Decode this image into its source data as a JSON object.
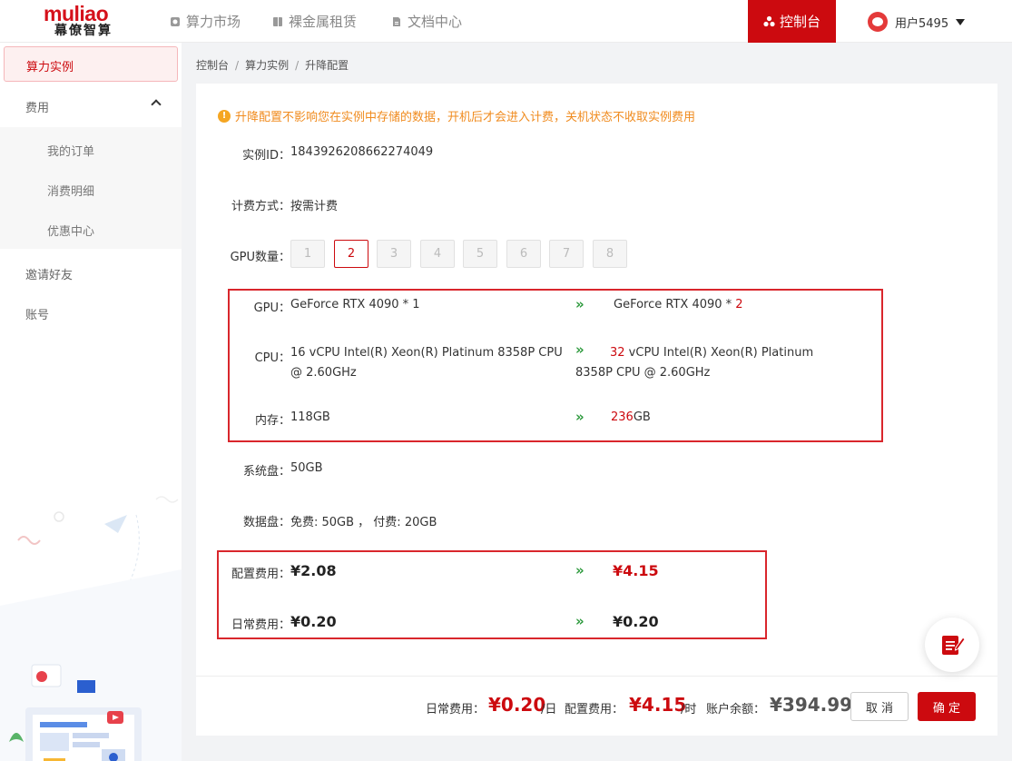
{
  "brand": {
    "logo_top": "muliao",
    "logo_bottom": "幕僚智算",
    "accent": "#cc0a0f"
  },
  "nav": {
    "items": [
      {
        "label": "算力市场",
        "icon": "cube-icon"
      },
      {
        "label": "裸金属租赁",
        "icon": "server-icon"
      },
      {
        "label": "文档中心",
        "icon": "document-icon"
      }
    ],
    "console_label": "控制台",
    "user_label": "用户5495"
  },
  "sidebar": {
    "active": "算力实例",
    "fees": "费用",
    "sub": [
      "我的订单",
      "消费明细",
      "优惠中心"
    ],
    "invite": "邀请好友",
    "account": "账号"
  },
  "breadcrumb": [
    "控制台",
    "算力实例",
    "升降配置"
  ],
  "notice": "升降配置不影响您在实例中存储的数据，开机后才会进入计费，关机状态不收取实例费用",
  "instance": {
    "id_label": "实例ID：",
    "id": "1843926208662274049",
    "billing_label": "计费方式：",
    "billing": "按需计费",
    "gpu_count_label": "GPU数量：",
    "gpu_options": [
      "1",
      "2",
      "3",
      "4",
      "5",
      "6",
      "7",
      "8"
    ],
    "gpu_selected": "2"
  },
  "compare": {
    "gpu_label": "GPU：",
    "gpu_old": "GeForce RTX 4090 * 1",
    "gpu_new_prefix": "GeForce RTX 4090 * ",
    "gpu_new_count": "2",
    "cpu_label": "CPU：",
    "cpu_old": "16 vCPU Intel(R) Xeon(R) Platinum 8358P CPU @ 2.60GHz",
    "cpu_new_count": "32",
    "cpu_new_rest": " vCPU Intel(R) Xeon(R) Platinum 8358P CPU @ 2.60GHz",
    "mem_label": "内存：",
    "mem_old": "118GB",
    "mem_new_num": "236",
    "mem_new_unit": "GB",
    "arrow": "»"
  },
  "disk": {
    "system_label": "系统盘：",
    "system": "50GB",
    "data_label": "数据盘：",
    "data": "免费: 50GB ， 付费: 20GB"
  },
  "fees": {
    "config_label": "配置费用：",
    "config_old": "¥2.08",
    "config_new": "¥4.15",
    "daily_label": "日常费用：",
    "daily_old": "¥0.20",
    "daily_new": "¥0.20"
  },
  "footer": {
    "daily_label": "日常费用：",
    "daily_price": "¥0.20",
    "daily_unit": "/日",
    "config_label": "配置费用：",
    "config_price": "¥4.15",
    "config_unit": "/时",
    "balance_label": "账户余额：",
    "balance": "¥394.99",
    "cancel": "取 消",
    "confirm": "确 定"
  }
}
